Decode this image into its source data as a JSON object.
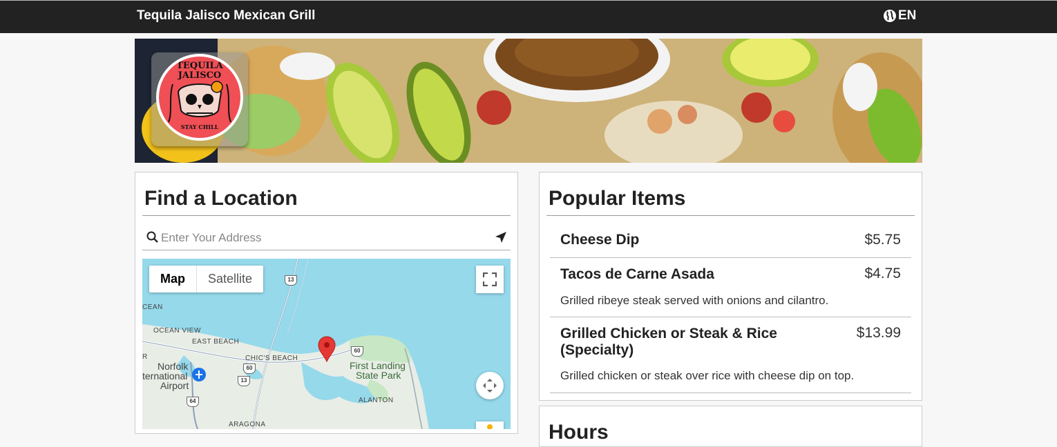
{
  "header": {
    "brand": "Tequila Jalisco Mexican Grill",
    "language": "EN",
    "language_icon": "globe-icon"
  },
  "logo": {
    "line1": "TEQUILA",
    "line2": "JALISCO",
    "tagline": "STAY CHILL"
  },
  "location": {
    "title": "Find a Location",
    "search_placeholder": "Enter Your Address",
    "search_value": "",
    "map_tab": "Map",
    "satellite_tab": "Satellite",
    "map_labels": {
      "ocean": "CEAN",
      "ocean_view": "OCEAN VIEW",
      "east_beach": "EAST BEACH",
      "chics_beach": "CHIC'S BEACH",
      "norfolk": "Norfolk",
      "international": "ternational",
      "airport": "Airport",
      "first_landing": "First Landing",
      "state_park": "State Park",
      "alanton": "ALANTON",
      "aragona": "ARAGONA",
      "r": "R"
    },
    "route_shields": [
      "13",
      "60",
      "60",
      "13",
      "64"
    ]
  },
  "popular": {
    "title": "Popular Items",
    "items": [
      {
        "name": "Cheese Dip",
        "price": "$5.75",
        "description": ""
      },
      {
        "name": "Tacos de Carne Asada",
        "price": "$4.75",
        "description": "Grilled ribeye steak served with onions and cilantro."
      },
      {
        "name": "Grilled Chicken or Steak & Rice (Specialty)",
        "price": "$13.99",
        "description": "Grilled chicken or steak over rice with cheese dip on top."
      }
    ]
  },
  "hours": {
    "title": "Hours"
  },
  "colors": {
    "topbar": "#222222",
    "water": "#95d9eb",
    "land": "#e8ede6",
    "logo_red": "#ef4f55",
    "pin": "#e53935"
  }
}
